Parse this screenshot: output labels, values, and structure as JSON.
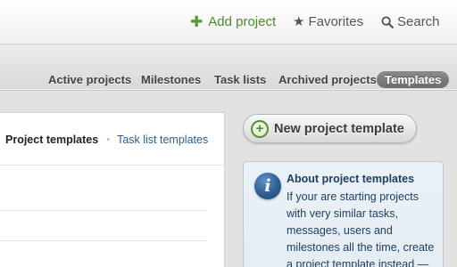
{
  "header": {
    "add_project": "Add project",
    "favorites": "Favorites",
    "search": "Search"
  },
  "nav": {
    "tabs": [
      {
        "label": "Active projects"
      },
      {
        "label": "Milestones"
      },
      {
        "label": "Task lists"
      },
      {
        "label": "Archived projects"
      },
      {
        "label": "Templates",
        "active": true
      }
    ]
  },
  "left_panel": {
    "tab_project_templates": "Project templates",
    "separator": "•",
    "tab_task_list_templates": "Task list templates"
  },
  "actions": {
    "new_project_template": "New project template"
  },
  "info": {
    "title": "About project templates",
    "body": "If your are starting projects with very similar tasks, messages, users and milestones all the time, create a project template instead —"
  },
  "colors": {
    "accent_green": "#4e8a2e",
    "link_blue": "#2a5d8f",
    "active_tab_bg": "#7a7a7a",
    "info_bg": "#e6eef4",
    "info_icon": "#2d5f94"
  },
  "icons": {
    "add": "plus-icon",
    "favorites": "star-icon",
    "search": "search-icon",
    "new_template": "circle-plus-icon",
    "info": "info-icon"
  }
}
